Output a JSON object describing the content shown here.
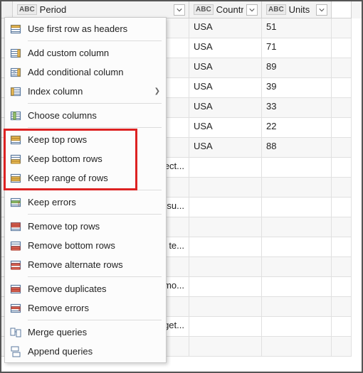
{
  "columns": {
    "period": {
      "type_prefix": "ABC",
      "label": "Period"
    },
    "country": {
      "type_prefix": "ABC",
      "label": "Country"
    },
    "units": {
      "type_prefix": "ABC",
      "label": "Units"
    }
  },
  "rows": [
    {
      "period": "",
      "country": "USA",
      "units": "51"
    },
    {
      "period": "",
      "country": "USA",
      "units": "71"
    },
    {
      "period": "",
      "country": "USA",
      "units": "89"
    },
    {
      "period": "",
      "country": "USA",
      "units": "39"
    },
    {
      "period": "",
      "country": "USA",
      "units": "33"
    },
    {
      "period": "",
      "country": "USA",
      "units": "22"
    },
    {
      "period": "",
      "country": "USA",
      "units": "88"
    },
    {
      "period": "consect...",
      "country": "",
      "units": ""
    },
    {
      "period": "",
      "country": "",
      "units": ""
    },
    {
      "period": "us risu...",
      "country": "",
      "units": ""
    },
    {
      "period": "",
      "country": "",
      "units": ""
    },
    {
      "period": "din te...",
      "country": "",
      "units": ""
    },
    {
      "period": "",
      "country": "",
      "units": ""
    },
    {
      "period": "ismo...",
      "country": "",
      "units": ""
    },
    {
      "period": "",
      "country": "",
      "units": ""
    },
    {
      "period": "t eget...",
      "country": "",
      "units": ""
    },
    {
      "period": "",
      "country": "",
      "units": ""
    }
  ],
  "menu": {
    "groups": [
      [
        {
          "id": "use-first-row-as-headers",
          "label": "Use first row as headers",
          "icon": "headers"
        }
      ],
      [
        {
          "id": "add-custom-column",
          "label": "Add custom column",
          "icon": "add-col"
        },
        {
          "id": "add-conditional-column",
          "label": "Add conditional column",
          "icon": "cond-col"
        },
        {
          "id": "index-column",
          "label": "Index column",
          "icon": "index-col",
          "submenu": true
        }
      ],
      [
        {
          "id": "choose-columns",
          "label": "Choose columns",
          "icon": "choose-cols"
        }
      ],
      [
        {
          "id": "keep-top-rows",
          "label": "Keep top rows",
          "icon": "keep-top"
        },
        {
          "id": "keep-bottom-rows",
          "label": "Keep bottom rows",
          "icon": "keep-bottom"
        },
        {
          "id": "keep-range-of-rows",
          "label": "Keep range of rows",
          "icon": "keep-range"
        }
      ],
      [
        {
          "id": "keep-errors",
          "label": "Keep errors",
          "icon": "keep-errors"
        }
      ],
      [
        {
          "id": "remove-top-rows",
          "label": "Remove top rows",
          "icon": "remove-top"
        },
        {
          "id": "remove-bottom-rows",
          "label": "Remove bottom rows",
          "icon": "remove-bottom"
        },
        {
          "id": "remove-alternate-rows",
          "label": "Remove alternate rows",
          "icon": "remove-alt"
        }
      ],
      [
        {
          "id": "remove-duplicates",
          "label": "Remove duplicates",
          "icon": "remove-dup"
        },
        {
          "id": "remove-errors",
          "label": "Remove errors",
          "icon": "remove-err"
        }
      ],
      [
        {
          "id": "merge-queries",
          "label": "Merge queries",
          "icon": "merge"
        },
        {
          "id": "append-queries",
          "label": "Append queries",
          "icon": "append"
        }
      ]
    ]
  },
  "highlight": {
    "target_group_index": 3
  }
}
